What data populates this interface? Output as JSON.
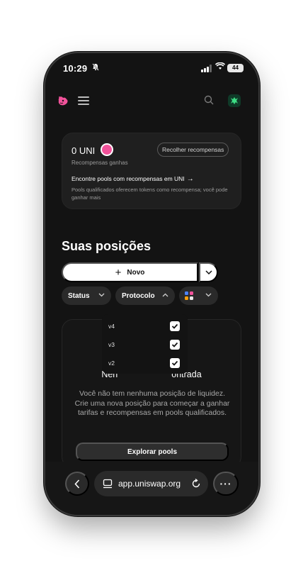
{
  "status_bar": {
    "time": "10:29",
    "battery": "44"
  },
  "header": {
    "logo_icon": "uniswap-unicorn-icon",
    "menu_icon": "hamburger-menu-icon",
    "search_icon": "search-icon",
    "avatar_icon": "account-avatar-icon"
  },
  "rewards": {
    "amount": "0 UNI",
    "label": "Recompensas ganhas",
    "collect_label": "Recolher recompensas",
    "find_pools_label": "Encontre pools com recompensas em UNI",
    "find_pools_arrow": "→",
    "description": "Pools qualificados oferecem tokens como recompensa; você pode ganhar mais"
  },
  "positions": {
    "title": "Suas posições",
    "new_label": "Novo",
    "filters": {
      "status_label": "Status",
      "protocol_label": "Protocolo"
    },
    "protocol_options": [
      {
        "label": "v4",
        "checked": true
      },
      {
        "label": "v3",
        "checked": true
      },
      {
        "label": "v2",
        "checked": true
      }
    ],
    "empty": {
      "title_left": "Nen",
      "title_right": "ontrada",
      "description": "Você não tem nenhuma posição de liquidez. Crie uma nova posição para começar a ganhar tarifas e recompensas em pools qualificados.",
      "explore_label": "Explorar pools"
    }
  },
  "browser": {
    "url": "app.uniswap.org",
    "more_label": "···"
  },
  "colors": {
    "accent_pink": "#f1529a",
    "background": "#131313",
    "card": "#1f1f1f"
  }
}
